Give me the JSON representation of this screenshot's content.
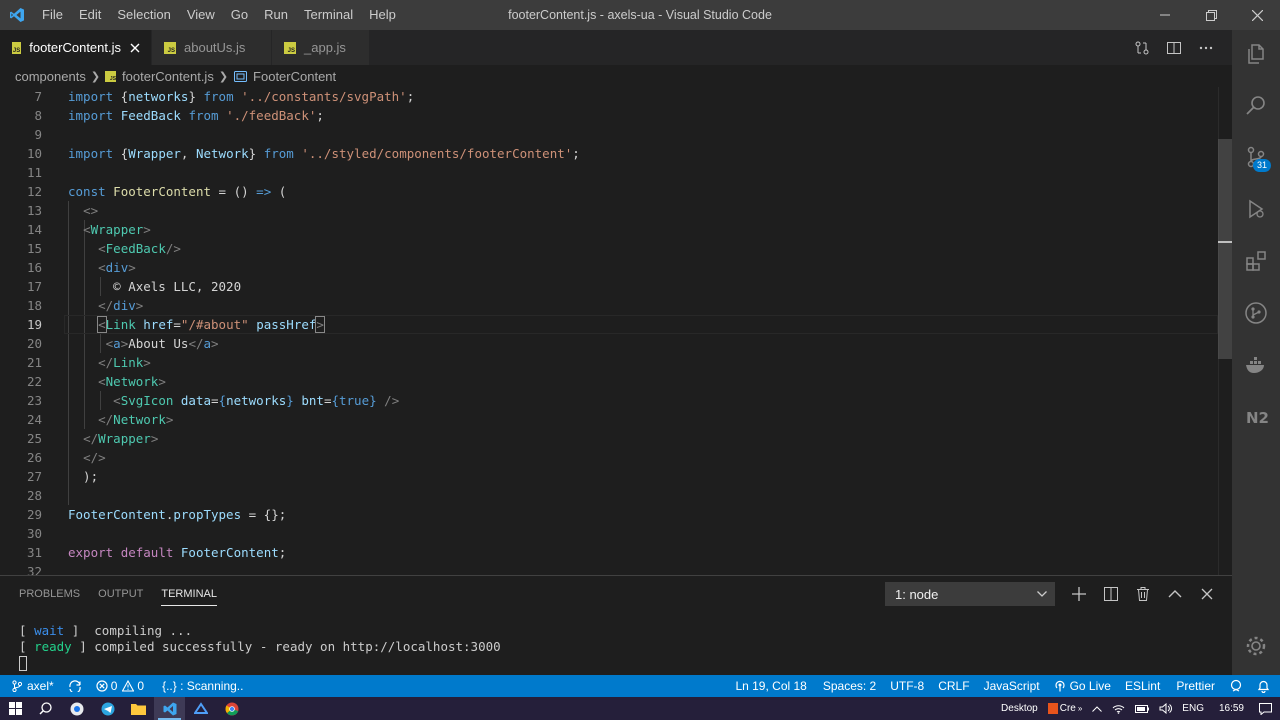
{
  "window": {
    "title": "footerContent.js - axels-ua - Visual Studio Code",
    "menu": [
      "File",
      "Edit",
      "Selection",
      "View",
      "Go",
      "Run",
      "Terminal",
      "Help"
    ]
  },
  "tabs": [
    {
      "label": "footerContent.js",
      "active": true
    },
    {
      "label": "aboutUs.js",
      "active": false
    },
    {
      "label": "_app.js",
      "active": false
    }
  ],
  "breadcrumb": {
    "folder": "components",
    "file": "footerContent.js",
    "symbol": "FooterContent"
  },
  "editor": {
    "line_numbers": [
      "7",
      "8",
      "9",
      "10",
      "11",
      "12",
      "13",
      "14",
      "15",
      "16",
      "17",
      "18",
      "19",
      "20",
      "21",
      "22",
      "23",
      "24",
      "25",
      "26",
      "27",
      "28",
      "29",
      "30",
      "31",
      "32"
    ],
    "current_line": "19",
    "lines": [
      [
        [
          "kw",
          "import"
        ],
        [
          "txt",
          " {"
        ],
        [
          "var",
          "networks"
        ],
        [
          "txt",
          "} "
        ],
        [
          "kw",
          "from"
        ],
        [
          "txt",
          " "
        ],
        [
          "str",
          "'../constants/svgPath'"
        ],
        [
          "txt",
          ";"
        ]
      ],
      [
        [
          "kw",
          "import"
        ],
        [
          "txt",
          " "
        ],
        [
          "var",
          "FeedBack"
        ],
        [
          "txt",
          " "
        ],
        [
          "kw",
          "from"
        ],
        [
          "txt",
          " "
        ],
        [
          "str",
          "'./feedBack'"
        ],
        [
          "txt",
          ";"
        ]
      ],
      [],
      [
        [
          "kw",
          "import"
        ],
        [
          "txt",
          " {"
        ],
        [
          "var",
          "Wrapper"
        ],
        [
          "txt",
          ", "
        ],
        [
          "var",
          "Network"
        ],
        [
          "txt",
          "} "
        ],
        [
          "kw",
          "from"
        ],
        [
          "txt",
          " "
        ],
        [
          "str",
          "'../styled/components/footerContent'"
        ],
        [
          "txt",
          ";"
        ]
      ],
      [],
      [
        [
          "kw",
          "const"
        ],
        [
          "txt",
          " "
        ],
        [
          "fn",
          "FooterContent"
        ],
        [
          "txt",
          " = () "
        ],
        [
          "kw",
          "=>"
        ],
        [
          "txt",
          " ("
        ]
      ],
      [
        [
          "txt",
          "  "
        ],
        [
          "tag",
          "<>"
        ]
      ],
      [
        [
          "txt",
          "  "
        ],
        [
          "tag",
          "<"
        ],
        [
          "tname",
          "Wrapper"
        ],
        [
          "tag",
          ">"
        ]
      ],
      [
        [
          "txt",
          "    "
        ],
        [
          "tag",
          "<"
        ],
        [
          "tname",
          "FeedBack"
        ],
        [
          "tag",
          "/>"
        ]
      ],
      [
        [
          "txt",
          "    "
        ],
        [
          "tag",
          "<"
        ],
        [
          "html",
          "div"
        ],
        [
          "tag",
          ">"
        ]
      ],
      [
        [
          "txt",
          "      © Axels LLC, 2020"
        ]
      ],
      [
        [
          "txt",
          "    "
        ],
        [
          "tag",
          "</"
        ],
        [
          "html",
          "div"
        ],
        [
          "tag",
          ">"
        ]
      ],
      [
        [
          "txt",
          "    "
        ],
        [
          "tagm",
          "<"
        ],
        [
          "tname",
          "Link"
        ],
        [
          "txt",
          " "
        ],
        [
          "attr",
          "href"
        ],
        [
          "txt",
          "="
        ],
        [
          "str",
          "\"/#about\""
        ],
        [
          "txt",
          " "
        ],
        [
          "attr",
          "passHref"
        ],
        [
          "tagm",
          ">"
        ]
      ],
      [
        [
          "txt",
          "     "
        ],
        [
          "tag",
          "<"
        ],
        [
          "html",
          "a"
        ],
        [
          "tag",
          ">"
        ],
        [
          "txt",
          "About Us"
        ],
        [
          "tag",
          "</"
        ],
        [
          "html",
          "a"
        ],
        [
          "tag",
          ">"
        ]
      ],
      [
        [
          "txt",
          "    "
        ],
        [
          "tag",
          "</"
        ],
        [
          "tname",
          "Link"
        ],
        [
          "tag",
          ">"
        ]
      ],
      [
        [
          "txt",
          "    "
        ],
        [
          "tag",
          "<"
        ],
        [
          "tname",
          "Network"
        ],
        [
          "tag",
          ">"
        ]
      ],
      [
        [
          "txt",
          "      "
        ],
        [
          "tag",
          "<"
        ],
        [
          "tname",
          "SvgIcon"
        ],
        [
          "txt",
          " "
        ],
        [
          "attr",
          "data"
        ],
        [
          "txt",
          "="
        ],
        [
          "kw",
          "{"
        ],
        [
          "var",
          "networks"
        ],
        [
          "kw",
          "}"
        ],
        [
          "txt",
          " "
        ],
        [
          "attr",
          "bnt"
        ],
        [
          "txt",
          "="
        ],
        [
          "kw",
          "{"
        ],
        [
          "kw",
          "true"
        ],
        [
          "kw",
          "}"
        ],
        [
          "txt",
          " "
        ],
        [
          "tag",
          "/>"
        ]
      ],
      [
        [
          "txt",
          "    "
        ],
        [
          "tag",
          "</"
        ],
        [
          "tname",
          "Network"
        ],
        [
          "tag",
          ">"
        ]
      ],
      [
        [
          "txt",
          "  "
        ],
        [
          "tag",
          "</"
        ],
        [
          "tname",
          "Wrapper"
        ],
        [
          "tag",
          ">"
        ]
      ],
      [
        [
          "txt",
          "  "
        ],
        [
          "tag",
          "</>"
        ]
      ],
      [
        [
          "txt",
          "  );"
        ]
      ],
      [],
      [
        [
          "var",
          "FooterContent"
        ],
        [
          "txt",
          "."
        ],
        [
          "var",
          "propTypes"
        ],
        [
          "txt",
          " = {};"
        ]
      ],
      [],
      [
        [
          "ctl",
          "export"
        ],
        [
          "txt",
          " "
        ],
        [
          "ctl",
          "default"
        ],
        [
          "txt",
          " "
        ],
        [
          "var",
          "FooterContent"
        ],
        [
          "txt",
          ";"
        ]
      ],
      []
    ]
  },
  "panel": {
    "tabs": [
      "PROBLEMS",
      "OUTPUT",
      "TERMINAL"
    ],
    "active_tab": "TERMINAL",
    "terminal_select": "1: node",
    "terminal": {
      "line1_open": "[ ",
      "line1_status": "wait",
      "line1_close": " ]  compiling ...",
      "line2_open": "[ ",
      "line2_status": "ready",
      "line2_close": " ] compiled successfully - ready on http://localhost:3000",
      "line3": "["
    }
  },
  "status": {
    "branch": "axel*",
    "errors": "0",
    "warnings": "0",
    "scanning": "{..} : Scanning..",
    "position": "Ln 19, Col 18",
    "spaces": "Spaces: 2",
    "encoding": "UTF-8",
    "eol": "CRLF",
    "language": "JavaScript",
    "golive": "Go Live",
    "eslint": "ESLint",
    "prettier": "Prettier"
  },
  "activity": {
    "scm_badge": "31"
  },
  "taskbar": {
    "desktop": "Desktop",
    "cre": "Cre",
    "lang": "ENG",
    "time": "16:59"
  },
  "colors": {
    "accent": "#007acc",
    "editor_bg": "#1e1e1e",
    "titlebar": "#3c3c3c"
  }
}
